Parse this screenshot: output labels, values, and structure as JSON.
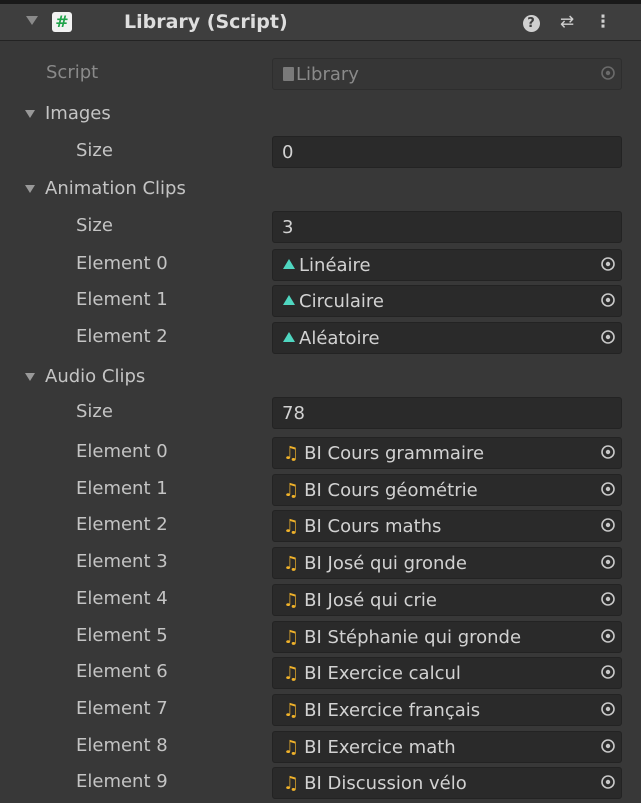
{
  "component": {
    "title": "Library (Script)",
    "help_icon": "?",
    "presets_icon": "sliders-icon",
    "menu_icon": "⋮"
  },
  "script": {
    "label": "Script",
    "value": "Library"
  },
  "images": {
    "label": "Images",
    "size_label": "Size",
    "size": "0"
  },
  "animation_clips": {
    "label": "Animation Clips",
    "size_label": "Size",
    "size": "3",
    "elements": [
      {
        "label": "Element 0",
        "value": "Linéaire"
      },
      {
        "label": "Element 1",
        "value": "Circulaire"
      },
      {
        "label": "Element 2",
        "value": "Aléatoire"
      }
    ]
  },
  "audio_clips": {
    "label": "Audio Clips",
    "size_label": "Size",
    "size": "78",
    "elements": [
      {
        "label": "Element 0",
        "value": "BI Cours grammaire"
      },
      {
        "label": "Element 1",
        "value": "BI Cours géométrie"
      },
      {
        "label": "Element 2",
        "value": "BI Cours maths"
      },
      {
        "label": "Element 3",
        "value": "BI José qui gronde"
      },
      {
        "label": "Element 4",
        "value": "BI José qui crie"
      },
      {
        "label": "Element 5",
        "value": "BI Stéphanie qui gronde"
      },
      {
        "label": "Element 6",
        "value": "BI Exercice calcul"
      },
      {
        "label": "Element 7",
        "value": "BI Exercice français"
      },
      {
        "label": "Element 8",
        "value": "BI Exercice math"
      },
      {
        "label": "Element 9",
        "value": "BI Discussion vélo"
      }
    ]
  },
  "colors": {
    "background": "#383838",
    "field": "#2a2a2a",
    "animation_icon": "#4fd6c0",
    "audio_icon": "#f0b22a"
  }
}
